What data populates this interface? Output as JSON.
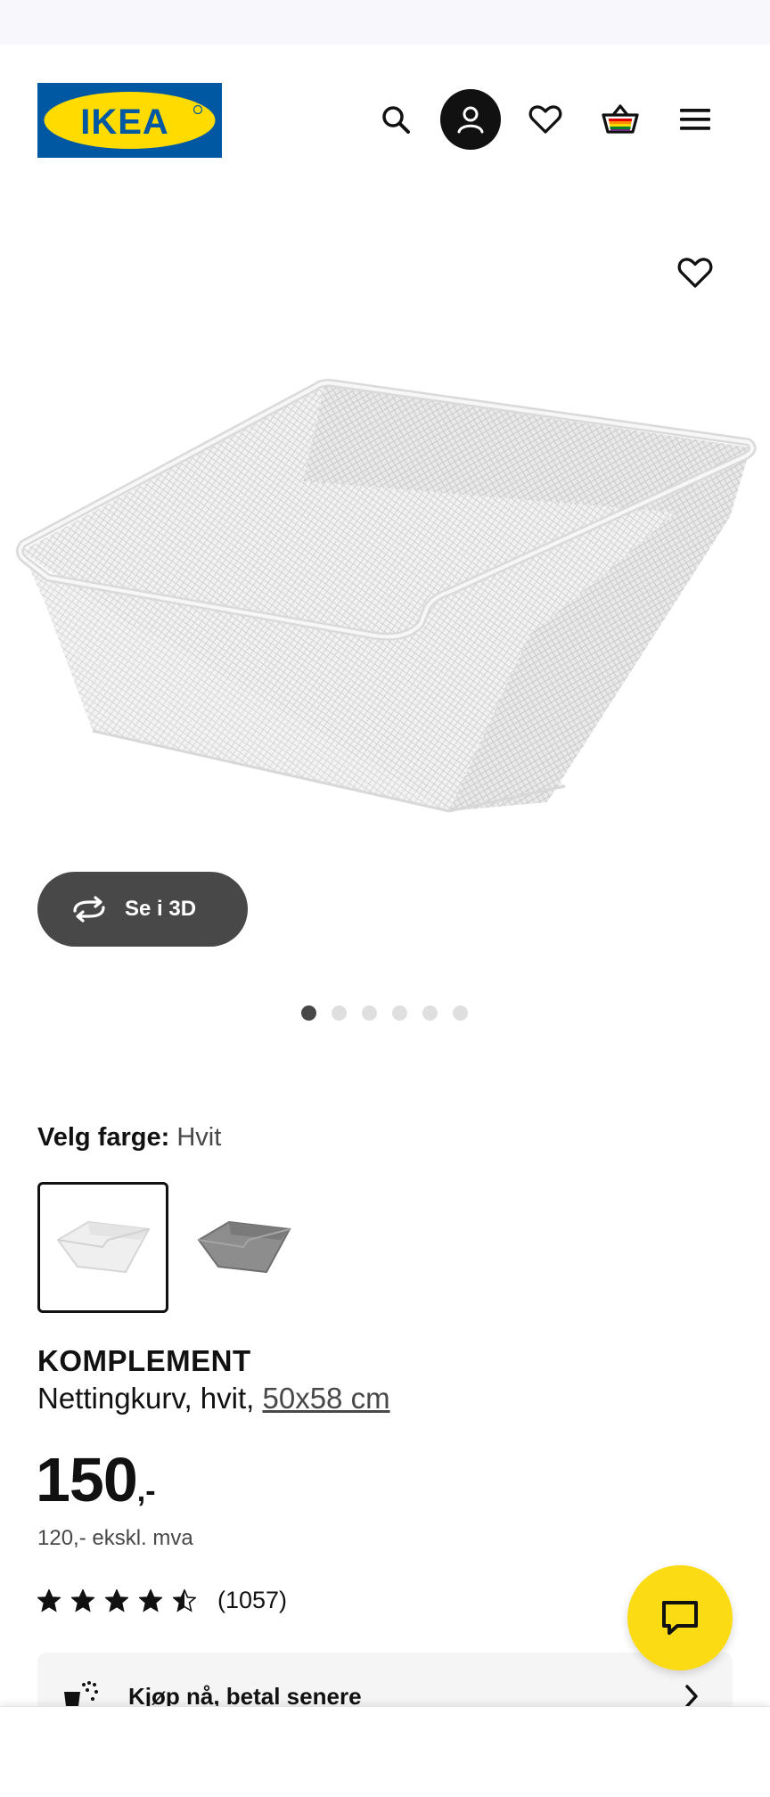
{
  "brand": {
    "logo_text": "IKEA",
    "logo_blue": "#0058a3",
    "logo_yellow": "#ffdb00"
  },
  "header": {
    "icons": [
      "search-icon",
      "account-icon",
      "heart-icon",
      "cart-icon",
      "hamburger-menu-icon"
    ]
  },
  "gallery": {
    "view_3d_label": "Se i 3D",
    "image_count": 6,
    "active_index": 0
  },
  "color_picker": {
    "label": "Velg farge:",
    "selected_value": "Hvit",
    "options": [
      "white-basket",
      "grey-basket"
    ]
  },
  "product": {
    "name": "KOMPLEMENT",
    "description": "Nettingkurv, hvit, ",
    "size": "50x58 cm",
    "price_int": "150",
    "price_dec": ",-",
    "price_ex_vat": "120,- ekskl. mva",
    "rating_value": 4.5,
    "rating_count": "(1057)"
  },
  "financing": {
    "label": "Kjøp nå, betal senere"
  },
  "colors": {
    "accent_yellow": "#fadb14",
    "dark_button": "#484848"
  }
}
